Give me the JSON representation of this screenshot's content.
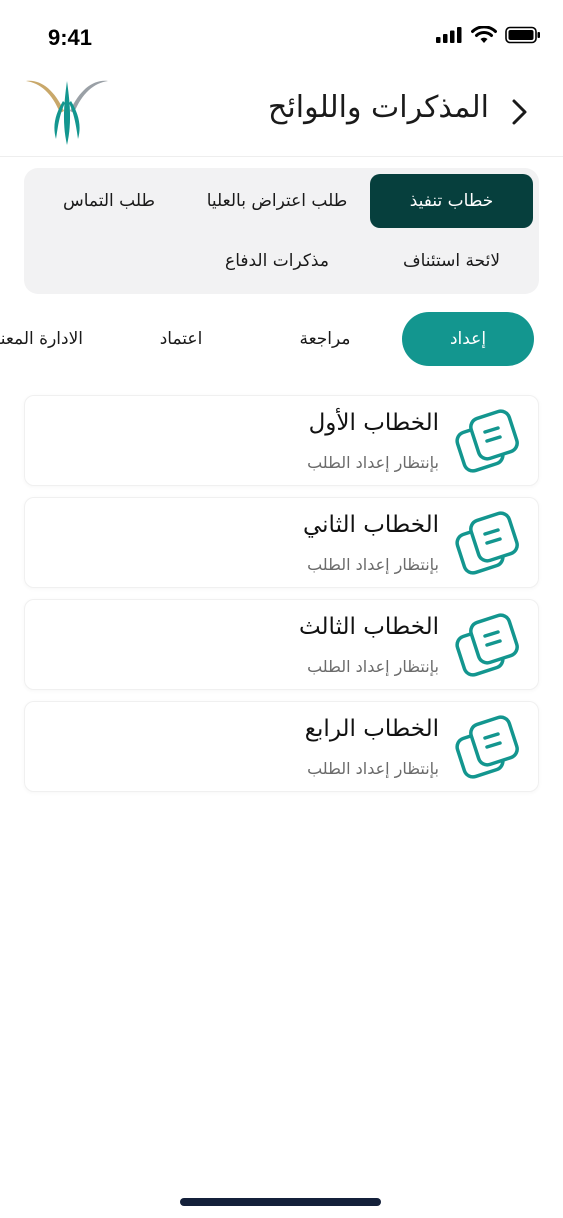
{
  "status_bar": {
    "time": "9:41"
  },
  "header": {
    "title": "المذكرات واللوائح"
  },
  "categories": [
    {
      "label": "خطاب تنفيذ",
      "active": true
    },
    {
      "label": "طلب اعتراض بالعليا",
      "active": false
    },
    {
      "label": "طلب التماس",
      "active": false
    },
    {
      "label": "لائحة استئناف",
      "active": false
    },
    {
      "label": "مذكرات الدفاع",
      "active": false
    }
  ],
  "stage_tabs": [
    {
      "label": "إعداد",
      "active": true
    },
    {
      "label": "مراجعة",
      "active": false
    },
    {
      "label": "اعتماد",
      "active": false
    },
    {
      "label": "الادارة المعنية",
      "active": false
    }
  ],
  "documents": [
    {
      "title": "الخطاب الأول",
      "status": "بإنتظار إعداد الطلب"
    },
    {
      "title": "الخطاب الثاني",
      "status": "بإنتظار إعداد الطلب"
    },
    {
      "title": "الخطاب الثالث",
      "status": "بإنتظار إعداد الطلب"
    },
    {
      "title": "الخطاب الرابع",
      "status": "بإنتظار إعداد الطلب"
    }
  ],
  "colors": {
    "primary_dark": "#063f3d",
    "primary": "#13968f",
    "panel_bg": "#f2f2f3",
    "logo_gold": "#c9a86a",
    "logo_gray": "#9aa0a6"
  },
  "icons": {
    "back": "chevron-right-icon",
    "document": "document-stack-icon",
    "signal": "cellular-signal-icon",
    "wifi": "wifi-icon",
    "battery": "battery-icon"
  }
}
